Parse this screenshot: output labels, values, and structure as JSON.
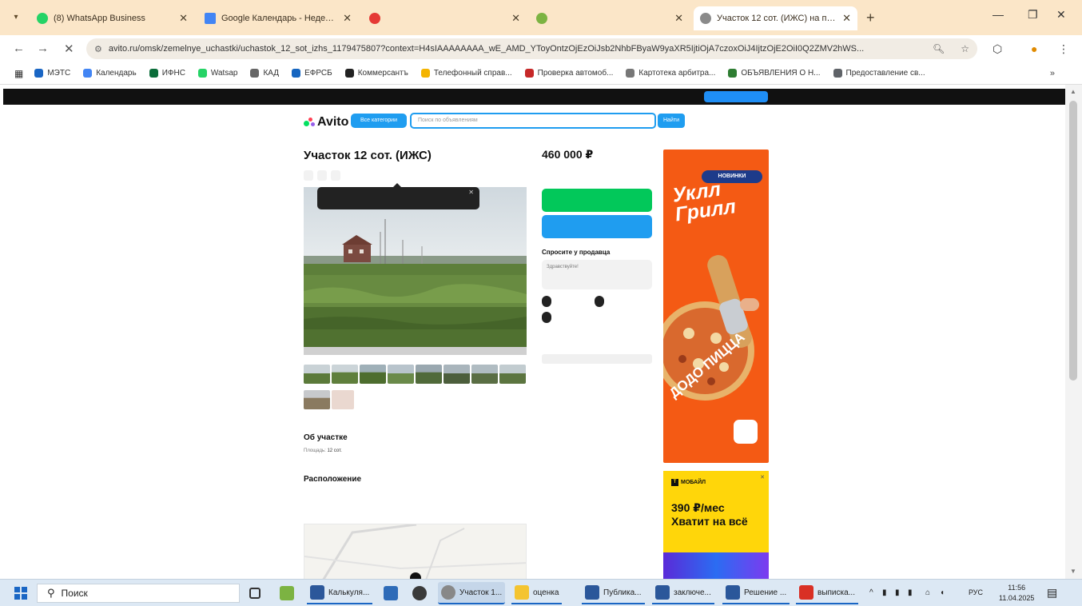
{
  "browser": {
    "tabs": [
      {
        "title": "(8) WhatsApp Business",
        "color": "#25d366",
        "active": false
      },
      {
        "title": "Google Календарь - Неделя 7",
        "color": "#4285f4",
        "active": false
      },
      {
        "title": "",
        "color": "#e53935",
        "active": false
      },
      {
        "title": "",
        "color": "#7cb342",
        "active": false
      },
      {
        "title": "Участок 12 сот. (ИЖС) на про...",
        "color": "#8a8a8a",
        "active": true
      }
    ],
    "url": "avito.ru/omsk/zemelnye_uchastki/uchastok_12_sot_izhs_1179475807?context=H4sIAAAAAAAA_wE_AMD_YToyOntzOjEzOiJsb2NhbFByaW9yaXR5IjtiOjA7czoxOiJ4IjtzOjE2OiI0Q2ZMV2hWS...",
    "bookmarks": [
      {
        "label": "МЭТС",
        "color": "#1a66c4"
      },
      {
        "label": "Календарь",
        "color": "#4285f4"
      },
      {
        "label": "ИФНС",
        "color": "#0b6d3a"
      },
      {
        "label": "Watsap",
        "color": "#25d366"
      },
      {
        "label": "КАД",
        "color": "#666666"
      },
      {
        "label": "ЕФРСБ",
        "color": "#1565c0"
      },
      {
        "label": "Коммерсантъ",
        "color": "#222222"
      },
      {
        "label": "Телефонный справ...",
        "color": "#f4b400"
      },
      {
        "label": "Проверка автомоб...",
        "color": "#c62828"
      },
      {
        "label": "Картотека арбитра...",
        "color": "#777777"
      },
      {
        "label": "ОБЪЯВЛЕНИЯ О Н...",
        "color": "#2e7d32"
      },
      {
        "label": "Предоставление св...",
        "color": "#5f6368"
      }
    ],
    "more_bookmarks": "»"
  },
  "avito": {
    "logo": "Avito",
    "all_categories": "Все категории",
    "search_placeholder": "Поиск по объявлениям",
    "search_button": "Найти",
    "region": "",
    "breadcrumb": "",
    "title": "Участок 12 сот. (ИЖС)",
    "actions": [
      "",
      "",
      ""
    ],
    "tooltip": "",
    "price": "460 000 ₽",
    "price_sub": "",
    "phone_button": "",
    "message_button": "",
    "ask_title": "Спросите у продавца",
    "ask_placeholder": "Здравствуйте!",
    "chips": [
      "",
      "",
      ""
    ],
    "seller_lines": [
      "",
      ""
    ],
    "seller_button": "",
    "about_title": "Об участке",
    "area_label": "Площадь:",
    "area_value": "12 сот.",
    "distance_label": "",
    "distance_value": "",
    "location_title": "Расположение",
    "address": "",
    "show_map": ""
  },
  "ads": {
    "dodo_badge": "НОВИНКИ",
    "dodo_slogan_1": "Уклл",
    "dodo_slogan_2": "Грилл",
    "dodo_small": "",
    "dodo_brand": "ДОДО ПИЦЦА",
    "dodo_logo": "",
    "tmobile_logo": "МОБАЙЛ",
    "tmobile_price": "390 ₽/мес",
    "tmobile_tagline": "Хватит на всё",
    "tmobile_fine": ""
  },
  "taskbar": {
    "search": "Поиск",
    "items": [
      {
        "label": "",
        "color": "#7cb342"
      },
      {
        "label": "",
        "color": "#f4a300"
      },
      {
        "label": "Калькуля...",
        "color": "#2b579a"
      },
      {
        "label": "",
        "color": "#2e6bb8"
      },
      {
        "label": "",
        "color": "#3a3a3a"
      },
      {
        "label": "Участок 1...",
        "color": "#888888"
      },
      {
        "label": "оценка",
        "color": "#f4c430"
      },
      {
        "label": "Публика...",
        "color": "#2b579a"
      },
      {
        "label": "заключе...",
        "color": "#2b579a"
      },
      {
        "label": "Решение ...",
        "color": "#2b579a"
      },
      {
        "label": "выписка...",
        "color": "#d93025"
      }
    ],
    "lang": "РУС",
    "time": "11:56",
    "date": "11.04.2025"
  }
}
